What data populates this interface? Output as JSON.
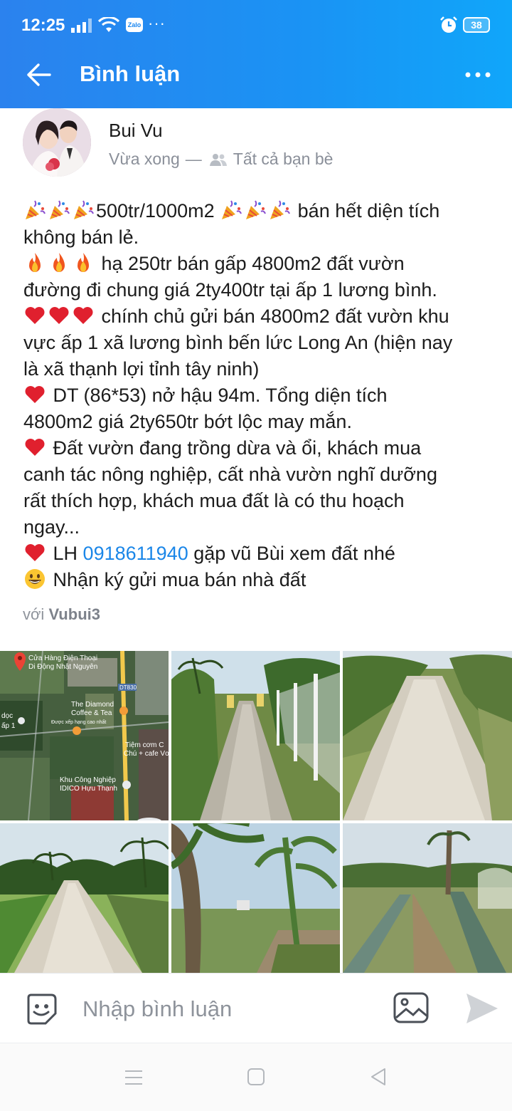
{
  "status_bar": {
    "time": "12:25",
    "notification_app": "Zalo",
    "more_notifications": "···",
    "battery": "38"
  },
  "header": {
    "title": "Bình luận",
    "back_icon": "arrow-left-icon",
    "menu_icon": "more-horizontal-icon"
  },
  "post": {
    "author": "Bui Vu",
    "time": "Vừa xong",
    "separator": "—",
    "audience": "Tất cả bạn bè",
    "lines": {
      "l1_price": "500tr/1000m2",
      "l1_rest": "bán hết diện tích",
      "l2": "không bán lẻ.",
      "l3": "hạ 250tr bán gấp 4800m2 đất vườn",
      "l4": "đường đi chung giá 2ty400tr tại ấp 1 lương bình.",
      "l5": "chính chủ gửi bán 4800m2 đất vườn khu",
      "l6": "vực ấp 1 xã lương bình bến lức Long An (hiện nay",
      "l7": "là xã thạnh lợi tỉnh tây ninh)",
      "l8": "DT (86*53) nở hậu 94m. Tổng diện tích",
      "l9": "4800m2 giá 2ty650tr bớt lộc may mắn.",
      "l10": "Đất vườn đang trồng dừa và ổi, khách mua",
      "l11": "canh tác nông nghiệp, cất nhà vườn nghĩ dưỡng",
      "l12": "rất thích hợp, khách mua đất là có thu hoạch",
      "l13": "ngay...",
      "l14_prefix": "LH",
      "l14_phone": "0918611940",
      "l14_rest": "gặp vũ Bùi xem đất nhé",
      "l15": "Nhận ký gửi mua bán nhà đất"
    },
    "tag_prefix": "với",
    "tag_user": "Vubui3"
  },
  "map_labels": {
    "shop": "Cửa Hàng Điện Thoại",
    "shop2": "Di Động Nhật Nguyên",
    "road": "DT830",
    "cafe": "The Diamond",
    "cafe2": "Coffee & Tea",
    "cafe3": "Được xếp hạng cao nhất",
    "rest": "Tiệm cơm C",
    "rest2": "Chú + cafe Vơ",
    "ind": "Khu Công Nghiệp",
    "ind2": "IDICO Hựu Thạnh",
    "left1": "dọc",
    "left2": "ấp 1"
  },
  "comment_bar": {
    "placeholder": "Nhập bình luận",
    "sticker_icon": "sticker-icon",
    "image_icon": "image-icon",
    "send_icon": "send-icon"
  },
  "colors": {
    "header_gradient_start": "#2b82ee",
    "header_gradient_end": "#10a6fa",
    "link": "#1a86e8",
    "heart": "#e0202e"
  }
}
